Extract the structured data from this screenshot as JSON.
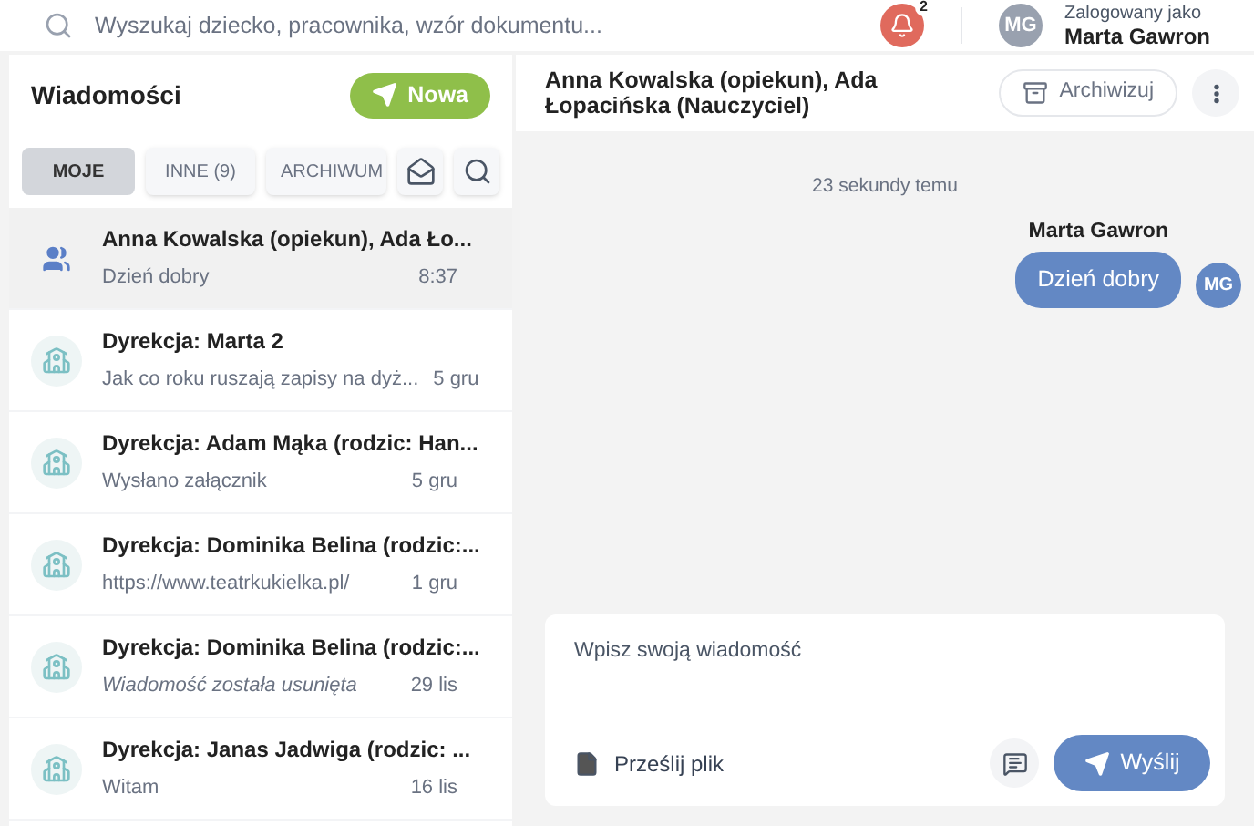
{
  "topbar": {
    "search": {
      "placeholder": "Wyszukaj dziecko, pracownika, wzór dokumentu..."
    },
    "notifications": {
      "badge": "2"
    },
    "user": {
      "initials": "MG",
      "caption": "Zalogowany jako",
      "name": "Marta Gawron"
    }
  },
  "sidebar": {
    "title": "Wiadomości",
    "new_button": "Nowa",
    "tabs": [
      {
        "label": "MOJE",
        "selected": true
      },
      {
        "label": "INNE (9)",
        "selected": false
      },
      {
        "label": "ARCHIWUM",
        "selected": false
      }
    ],
    "threads": [
      {
        "kind": "group",
        "title": "Anna Kowalska (opiekun), Ada Ło...",
        "preview": "Dzień dobry",
        "time": "8:37",
        "selected": true,
        "italic": false
      },
      {
        "kind": "school",
        "title": "Dyrekcja: Marta 2",
        "preview": "Jak co roku ruszają zapisy na dyż...",
        "time": "5 gru",
        "selected": false,
        "italic": false
      },
      {
        "kind": "school",
        "title": "Dyrekcja: Adam Mąka (rodzic: Han...",
        "preview": "Wysłano załącznik",
        "time": "5 gru",
        "selected": false,
        "italic": false
      },
      {
        "kind": "school",
        "title": "Dyrekcja: Dominika Belina (rodzic:...",
        "preview": "https://www.teatrkukielka.pl/",
        "time": "1 gru",
        "selected": false,
        "italic": false
      },
      {
        "kind": "school",
        "title": "Dyrekcja: Dominika Belina (rodzic:...",
        "preview": "Wiadomość została usunięta",
        "time": "29 lis",
        "selected": false,
        "italic": true
      },
      {
        "kind": "school",
        "title": "Dyrekcja: Janas Jadwiga (rodzic: ...",
        "preview": "Witam",
        "time": "16 lis",
        "selected": false,
        "italic": false
      }
    ]
  },
  "conversation": {
    "title": "Anna Kowalska (opiekun), Ada Łopacińska (Nauczyciel)",
    "archive_button": "Archiwizuj",
    "timestamp": "23 sekundy temu",
    "messages": [
      {
        "author": "Marta Gawron",
        "text": "Dzień dobry",
        "initials": "MG"
      }
    ],
    "composer": {
      "placeholder": "Wpisz swoją wiadomość",
      "attach": "Prześlij plik",
      "send": "Wyślij"
    }
  }
}
